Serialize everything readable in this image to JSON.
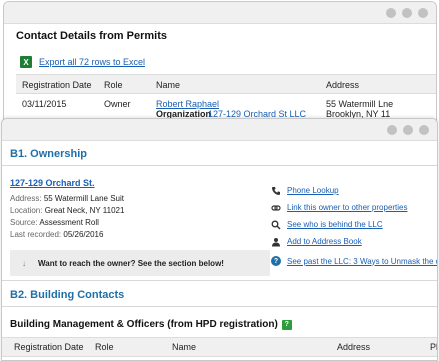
{
  "back_window": {
    "title": "Contact Details from Permits",
    "export_label": "Export all 72 rows to Excel",
    "excel_icon_letter": "X",
    "columns": [
      "Registration Date",
      "Role",
      "Name",
      "Address"
    ],
    "row": {
      "date": "03/11/2015",
      "role": "Owner",
      "name": "Robert Raphael",
      "org_label": "Organization",
      "org_name": "127-129 Orchard St LLC",
      "address_line1": "55 Watermill Lne",
      "address_line2": "Brooklyn, NY 11"
    }
  },
  "front_window": {
    "ownership_title": "B1. Ownership",
    "owner_name": "127-129 Orchard St.",
    "address_label": "Address:",
    "address_value": "55 Watermill Lane Suit",
    "location_label": "Location:",
    "location_value": "Great Neck, NY 11021",
    "source_label": "Source:",
    "source_value": "Assessment Roll",
    "last_recorded_label": "Last recorded:",
    "last_recorded_value": "05/26/2016",
    "actions": [
      {
        "label": "Phone Lookup",
        "icon": "phone-icon"
      },
      {
        "label": "Link this owner to other properties",
        "icon": "link-icon"
      },
      {
        "label": "See who is behind the LLC",
        "icon": "search-icon"
      },
      {
        "label": "Add to Address Book",
        "icon": "person-icon"
      }
    ],
    "reach_text": "Want to reach the owner? See the section below!",
    "beyond_llc": "See past the LLC: 3 Ways to Unmask the o",
    "building_contacts_title": "B2. Building Contacts",
    "mgmt_title": "Building Management & Officers (from HPD registration)",
    "table_columns": [
      "Registration Date",
      "Role",
      "Name",
      "Address",
      "Pl"
    ]
  },
  "colors": {
    "section_title": "#1f6fa8",
    "link": "#1a5fb4",
    "excel_green": "#1e7e34",
    "hpd_badge": "#2e9c3c"
  }
}
